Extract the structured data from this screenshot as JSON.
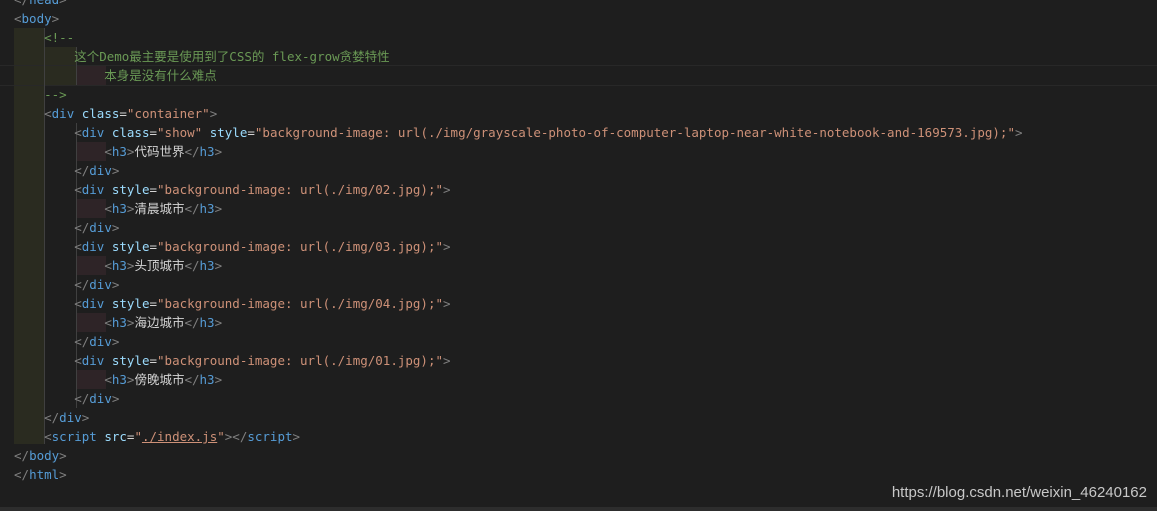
{
  "lines": [
    {
      "parts": [
        [
          "punct",
          "</"
        ],
        [
          "tag",
          "head"
        ],
        [
          "punct",
          ">"
        ]
      ]
    },
    {
      "parts": [
        [
          "punct",
          "<"
        ],
        [
          "tag",
          "body"
        ],
        [
          "punct",
          ">"
        ]
      ]
    },
    {
      "parts": [
        [
          "comment",
          "    <!--"
        ]
      ]
    },
    {
      "parts": [
        [
          "comment",
          "        这个Demo最主要是使用到了CSS的 flex-grow贪婪特性"
        ]
      ]
    },
    {
      "parts": [
        [
          "comment",
          "            本身是没有什么难点"
        ]
      ]
    },
    {
      "parts": [
        [
          "comment",
          "    -->"
        ]
      ]
    },
    {
      "parts": [
        [
          "text",
          "    "
        ],
        [
          "punct",
          "<"
        ],
        [
          "tag",
          "div"
        ],
        [
          "text",
          " "
        ],
        [
          "attr",
          "class"
        ],
        [
          "text",
          "="
        ],
        [
          "str",
          "\"container\""
        ],
        [
          "punct",
          ">"
        ]
      ]
    },
    {
      "parts": [
        [
          "text",
          "        "
        ],
        [
          "punct",
          "<"
        ],
        [
          "tag",
          "div"
        ],
        [
          "text",
          " "
        ],
        [
          "attr",
          "class"
        ],
        [
          "text",
          "="
        ],
        [
          "str",
          "\"show\""
        ],
        [
          "text",
          " "
        ],
        [
          "attr",
          "style"
        ],
        [
          "text",
          "="
        ],
        [
          "str",
          "\"background-image: url(./img/grayscale-photo-of-computer-laptop-near-white-notebook-and-169573.jpg);\""
        ],
        [
          "punct",
          ">"
        ]
      ]
    },
    {
      "parts": [
        [
          "text",
          "            "
        ],
        [
          "punct",
          "<"
        ],
        [
          "tag",
          "h3"
        ],
        [
          "punct",
          ">"
        ],
        [
          "text",
          "代码世界"
        ],
        [
          "punct",
          "</"
        ],
        [
          "tag",
          "h3"
        ],
        [
          "punct",
          ">"
        ]
      ]
    },
    {
      "parts": [
        [
          "text",
          "        "
        ],
        [
          "punct",
          "</"
        ],
        [
          "tag",
          "div"
        ],
        [
          "punct",
          ">"
        ]
      ]
    },
    {
      "parts": [
        [
          "text",
          "        "
        ],
        [
          "punct",
          "<"
        ],
        [
          "tag",
          "div"
        ],
        [
          "text",
          " "
        ],
        [
          "attr",
          "style"
        ],
        [
          "text",
          "="
        ],
        [
          "str",
          "\"background-image: url(./img/02.jpg);\""
        ],
        [
          "punct",
          ">"
        ]
      ]
    },
    {
      "parts": [
        [
          "text",
          "            "
        ],
        [
          "punct",
          "<"
        ],
        [
          "tag",
          "h3"
        ],
        [
          "punct",
          ">"
        ],
        [
          "text",
          "清晨城市"
        ],
        [
          "punct",
          "</"
        ],
        [
          "tag",
          "h3"
        ],
        [
          "punct",
          ">"
        ]
      ]
    },
    {
      "parts": [
        [
          "text",
          "        "
        ],
        [
          "punct",
          "</"
        ],
        [
          "tag",
          "div"
        ],
        [
          "punct",
          ">"
        ]
      ]
    },
    {
      "parts": [
        [
          "text",
          "        "
        ],
        [
          "punct",
          "<"
        ],
        [
          "tag",
          "div"
        ],
        [
          "text",
          " "
        ],
        [
          "attr",
          "style"
        ],
        [
          "text",
          "="
        ],
        [
          "str",
          "\"background-image: url(./img/03.jpg);\""
        ],
        [
          "punct",
          ">"
        ]
      ]
    },
    {
      "parts": [
        [
          "text",
          "            "
        ],
        [
          "punct",
          "<"
        ],
        [
          "tag",
          "h3"
        ],
        [
          "punct",
          ">"
        ],
        [
          "text",
          "头顶城市"
        ],
        [
          "punct",
          "</"
        ],
        [
          "tag",
          "h3"
        ],
        [
          "punct",
          ">"
        ]
      ]
    },
    {
      "parts": [
        [
          "text",
          "        "
        ],
        [
          "punct",
          "</"
        ],
        [
          "tag",
          "div"
        ],
        [
          "punct",
          ">"
        ]
      ]
    },
    {
      "parts": [
        [
          "text",
          "        "
        ],
        [
          "punct",
          "<"
        ],
        [
          "tag",
          "div"
        ],
        [
          "text",
          " "
        ],
        [
          "attr",
          "style"
        ],
        [
          "text",
          "="
        ],
        [
          "str",
          "\"background-image: url(./img/04.jpg);\""
        ],
        [
          "punct",
          ">"
        ]
      ]
    },
    {
      "parts": [
        [
          "text",
          "            "
        ],
        [
          "punct",
          "<"
        ],
        [
          "tag",
          "h3"
        ],
        [
          "punct",
          ">"
        ],
        [
          "text",
          "海边城市"
        ],
        [
          "punct",
          "</"
        ],
        [
          "tag",
          "h3"
        ],
        [
          "punct",
          ">"
        ]
      ]
    },
    {
      "parts": [
        [
          "text",
          "        "
        ],
        [
          "punct",
          "</"
        ],
        [
          "tag",
          "div"
        ],
        [
          "punct",
          ">"
        ]
      ]
    },
    {
      "parts": [
        [
          "text",
          "        "
        ],
        [
          "punct",
          "<"
        ],
        [
          "tag",
          "div"
        ],
        [
          "text",
          " "
        ],
        [
          "attr",
          "style"
        ],
        [
          "text",
          "="
        ],
        [
          "str",
          "\"background-image: url(./img/01.jpg);\""
        ],
        [
          "punct",
          ">"
        ]
      ]
    },
    {
      "parts": [
        [
          "text",
          "            "
        ],
        [
          "punct",
          "<"
        ],
        [
          "tag",
          "h3"
        ],
        [
          "punct",
          ">"
        ],
        [
          "text",
          "傍晚城市"
        ],
        [
          "punct",
          "</"
        ],
        [
          "tag",
          "h3"
        ],
        [
          "punct",
          ">"
        ]
      ]
    },
    {
      "parts": [
        [
          "text",
          "        "
        ],
        [
          "punct",
          "</"
        ],
        [
          "tag",
          "div"
        ],
        [
          "punct",
          ">"
        ]
      ]
    },
    {
      "parts": [
        [
          "text",
          "    "
        ],
        [
          "punct",
          "</"
        ],
        [
          "tag",
          "div"
        ],
        [
          "punct",
          ">"
        ]
      ]
    },
    {
      "parts": [
        [
          "text",
          "    "
        ],
        [
          "punct",
          "<"
        ],
        [
          "tag",
          "script"
        ],
        [
          "text",
          " "
        ],
        [
          "attr",
          "src"
        ],
        [
          "text",
          "="
        ],
        [
          "str",
          "\""
        ],
        [
          "strlink",
          "./index.js"
        ],
        [
          "str",
          "\""
        ],
        [
          "punct",
          "></"
        ],
        [
          "tag",
          "script"
        ],
        [
          "punct",
          ">"
        ]
      ]
    },
    {
      "parts": [
        [
          "punct",
          "</"
        ],
        [
          "tag",
          "body"
        ],
        [
          "punct",
          ">"
        ]
      ]
    },
    {
      "parts": [
        [
          "punct",
          "</"
        ],
        [
          "tag",
          "html"
        ],
        [
          "punct",
          ">"
        ]
      ]
    }
  ],
  "watermark": "https://blog.csdn.net/weixin_46240162"
}
